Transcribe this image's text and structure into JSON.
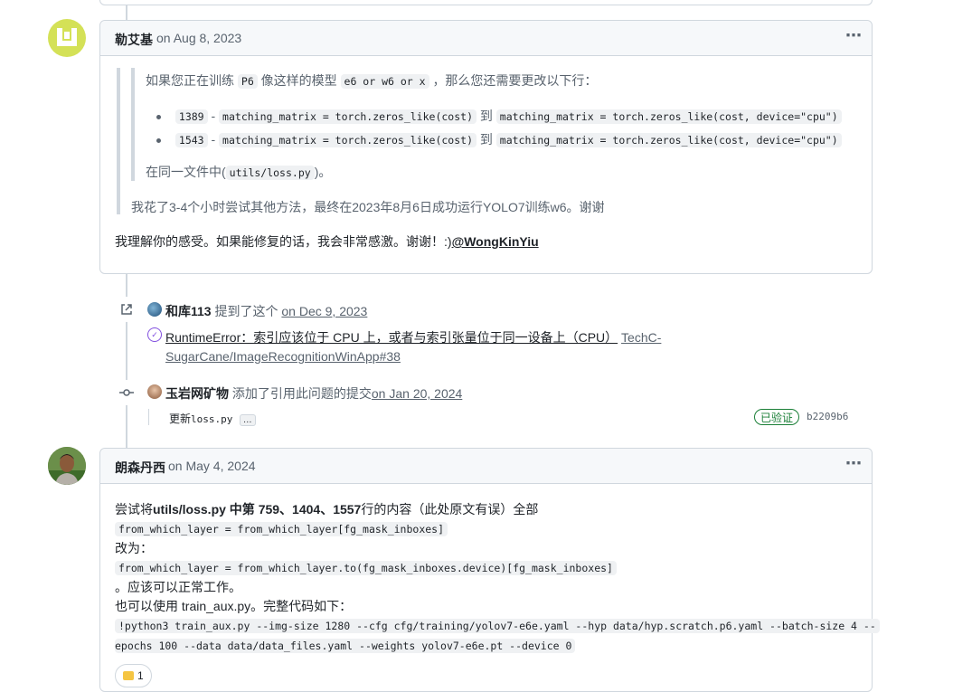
{
  "comment1": {
    "author": "勒艾基",
    "date": "on Aug 8, 2023",
    "quote_intro_a": "如果您正在训练",
    "quote_code_a": "P6",
    "quote_intro_b": "像这样的模型",
    "quote_code_b": "e6 or w6 or x",
    "quote_intro_c": "，那么您还需要更改以下行：",
    "bullets": [
      {
        "num": "1389",
        "sep": "-",
        "from": "matching_matrix = torch.zeros_like(cost)",
        "to_word": "到",
        "to": "matching_matrix = torch.zeros_like(cost, device=\"cpu\")"
      },
      {
        "num": "1543",
        "sep": "-",
        "from": "matching_matrix = torch.zeros_like(cost)",
        "to_word": "到",
        "to": "matching_matrix = torch.zeros_like(cost, device=\"cpu\")"
      }
    ],
    "file_prefix": "在同一文件中(",
    "file_code": "utils/loss.py",
    "file_suffix": ")。",
    "quote_outer": "我花了3-4个小时尝试其他方法，最终在2023年8月6日成功运行YOLO7训练w6。谢谢",
    "body": "我理解你的感受。如果能修复的话，我会非常感激。谢谢！:)",
    "mention": "@WongKinYiu"
  },
  "event1": {
    "user": "和库113",
    "action": "提到了这个",
    "date": "on Dec 9, 2023",
    "issue_title": "RuntimeError：索引应该位于 CPU 上，或者与索引张量位于同一设备上（CPU）",
    "repo_a": "TechC-",
    "repo_b": "SugarCane/ImageRecognitionWinApp#38"
  },
  "event2": {
    "user": "玉岩网矿物",
    "action": "添加了引用此问题的提交",
    "date": "on Jan 20, 2024",
    "commit_prefix": "更新",
    "commit_file": "loss.py",
    "ellipsis": "…",
    "verified": "已验证",
    "sha": "b2209b6"
  },
  "comment2": {
    "author": "朗森丹西",
    "date": "on May 4, 2024",
    "line1_a": "尝试将",
    "line1_b": "utils/loss.py 中第 759、1404、1557",
    "line1_c": "行的内容（此处原文有误）全部",
    "code1": "from_which_layer = from_which_layer[fg_mask_inboxes]",
    "change_to": "改为：",
    "code2": "from_which_layer = from_which_layer.to(fg_mask_inboxes.device)[fg_mask_inboxes]",
    "works": "。应该可以正常工作。",
    "also": "也可以使用 train_aux.py。完整代码如下：",
    "cmd1": "!python3 train_aux.py --img-size 1280 --cfg cfg/training/yolov7-e6e.yaml --hyp data/hyp.scratch.p6.yaml --batch-size 4 --",
    "cmd2": "epochs 100 --data data/data_files.yaml --weights yolov7-e6e.pt --device 0",
    "reaction_count": "1"
  },
  "icons": {
    "kebab": "⋯",
    "cross_ref": "↗",
    "commit": "-o-",
    "issue_check": "✓"
  }
}
